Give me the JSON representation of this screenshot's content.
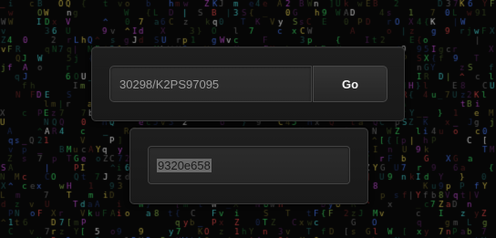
{
  "url_input": {
    "value": "30298/K2PS97095"
  },
  "go_button": {
    "label": "Go"
  },
  "result_field": {
    "value": "9320e658"
  },
  "colors": {
    "background": "#060606",
    "panel": "#1c1c1c",
    "panel_border": "#383838",
    "field": "#2c2c2c",
    "input_text": "#9e9e9e",
    "button_text": "#f2f2f2",
    "selection_highlight": "#6a6a6a",
    "matrix_glyph_palette": [
      "#2fa84f",
      "#3a5fbf",
      "#b03a3a",
      "#b0a040",
      "#9a3fa8",
      "#3aa8a8",
      "#cfcfcf",
      "#6a8a3a"
    ]
  }
}
